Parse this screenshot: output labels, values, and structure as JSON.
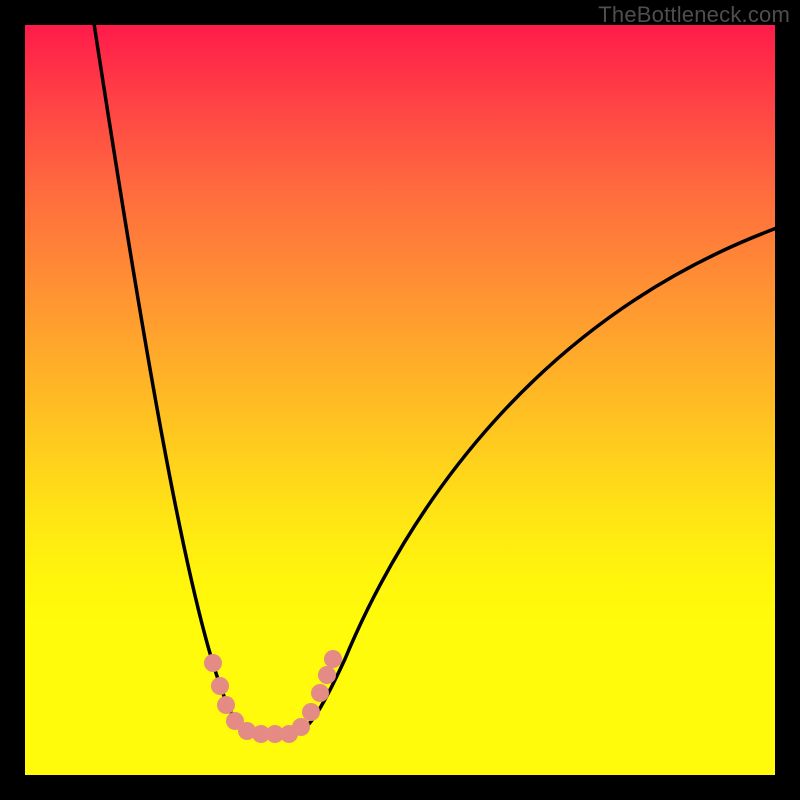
{
  "watermark": "TheBottleneck.com",
  "chart_data": {
    "type": "line",
    "title": "",
    "xlabel": "",
    "ylabel": "",
    "xlim": [
      0,
      100
    ],
    "ylim": [
      0,
      100
    ],
    "series": [
      {
        "name": "bottleneck-curve",
        "x": [
          9,
          12,
          15,
          18,
          21,
          24,
          26,
          28,
          30,
          32,
          34,
          36,
          38,
          40,
          42,
          45,
          50,
          55,
          60,
          70,
          80,
          90,
          100
        ],
        "y": [
          101,
          80,
          60,
          44,
          32,
          22,
          15,
          10,
          6,
          5.5,
          5.5,
          6,
          9,
          14,
          20,
          28,
          40,
          50,
          58,
          67,
          72,
          75,
          77
        ]
      }
    ],
    "markers": {
      "name": "highlight-band",
      "color": "#e48b85",
      "x": [
        25,
        26,
        27,
        28,
        30,
        31,
        33,
        35,
        37,
        38,
        39,
        40,
        41
      ],
      "y": [
        15,
        12,
        9,
        7,
        6,
        5.5,
        5.5,
        5.5,
        6,
        8,
        11,
        13,
        15
      ]
    },
    "background": {
      "type": "vertical-gradient",
      "stops": [
        {
          "pos": 0.0,
          "color": "#ff1b4a"
        },
        {
          "pos": 0.22,
          "color": "#ff6b3e"
        },
        {
          "pos": 0.46,
          "color": "#ffb028"
        },
        {
          "pos": 0.73,
          "color": "#fff40d"
        },
        {
          "pos": 0.8,
          "color": "#fcfccf"
        },
        {
          "pos": 0.88,
          "color": "#96f152"
        },
        {
          "pos": 0.93,
          "color": "#22eb7e"
        },
        {
          "pos": 1.0,
          "color": "#07ca6b"
        }
      ]
    }
  }
}
